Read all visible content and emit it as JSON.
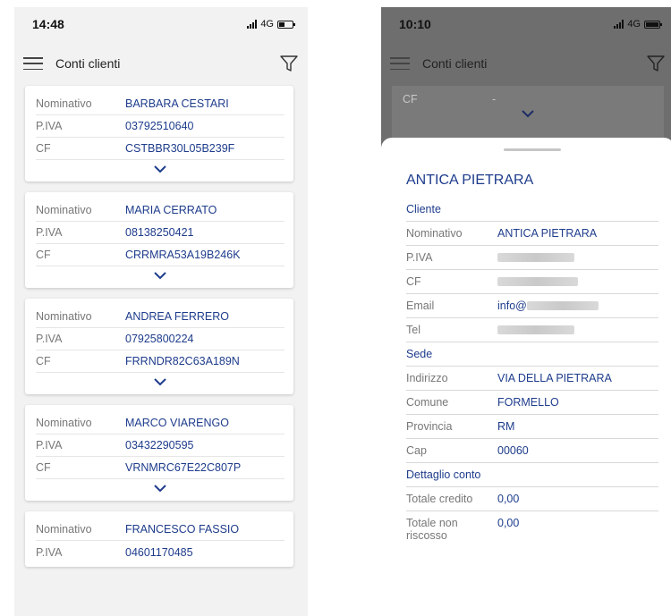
{
  "left": {
    "time": "14:48",
    "network": "4G",
    "title": "Conti clienti",
    "cards": [
      {
        "rows": [
          {
            "label": "Nominativo",
            "value": "BARBARA CESTARI"
          },
          {
            "label": "P.IVA",
            "value": "03792510640"
          },
          {
            "label": "CF",
            "value": "CSTBBR30L05B239F"
          }
        ]
      },
      {
        "rows": [
          {
            "label": "Nominativo",
            "value": "MARIA CERRATO"
          },
          {
            "label": "P.IVA",
            "value": "08138250421"
          },
          {
            "label": "CF",
            "value": "CRRMRA53A19B246K"
          }
        ]
      },
      {
        "rows": [
          {
            "label": "Nominativo",
            "value": "ANDREA FERRERO"
          },
          {
            "label": "P.IVA",
            "value": "07925800224"
          },
          {
            "label": "CF",
            "value": "FRRNDR82C63A189N"
          }
        ]
      },
      {
        "rows": [
          {
            "label": "Nominativo",
            "value": "MARCO VIARENGO"
          },
          {
            "label": "P.IVA",
            "value": "03432290595"
          },
          {
            "label": "CF",
            "value": "VRNMRC67E22C807P"
          }
        ]
      },
      {
        "rows": [
          {
            "label": "Nominativo",
            "value": "FRANCESCO FASSIO"
          },
          {
            "label": "P.IVA",
            "value": "04601170485"
          }
        ]
      }
    ]
  },
  "right": {
    "time": "10:10",
    "network": "4G",
    "title": "Conti clienti",
    "bg_row": {
      "label": "CF",
      "value": "-"
    },
    "sheet": {
      "title": "ANTICA PIETRARA",
      "sections": {
        "cliente": "Cliente",
        "sede": "Sede",
        "dettaglio": "Dettaglio conto"
      },
      "cliente_rows": {
        "nominativo": {
          "label": "Nominativo",
          "value": "ANTICA PIETRARA"
        },
        "piva": {
          "label": "P.IVA"
        },
        "cf": {
          "label": "CF"
        },
        "email": {
          "label": "Email",
          "value": "info@"
        },
        "tel": {
          "label": "Tel"
        }
      },
      "sede_rows": {
        "indirizzo": {
          "label": "Indirizzo",
          "value": "VIA DELLA PIETRARA"
        },
        "comune": {
          "label": "Comune",
          "value": "FORMELLO"
        },
        "provincia": {
          "label": "Provincia",
          "value": "RM"
        },
        "cap": {
          "label": "Cap",
          "value": "00060"
        }
      },
      "conto_rows": {
        "credito": {
          "label": "Totale credito",
          "value": "0,00"
        },
        "non_riscosso": {
          "label": "Totale non riscosso",
          "value": "0,00"
        }
      }
    }
  }
}
